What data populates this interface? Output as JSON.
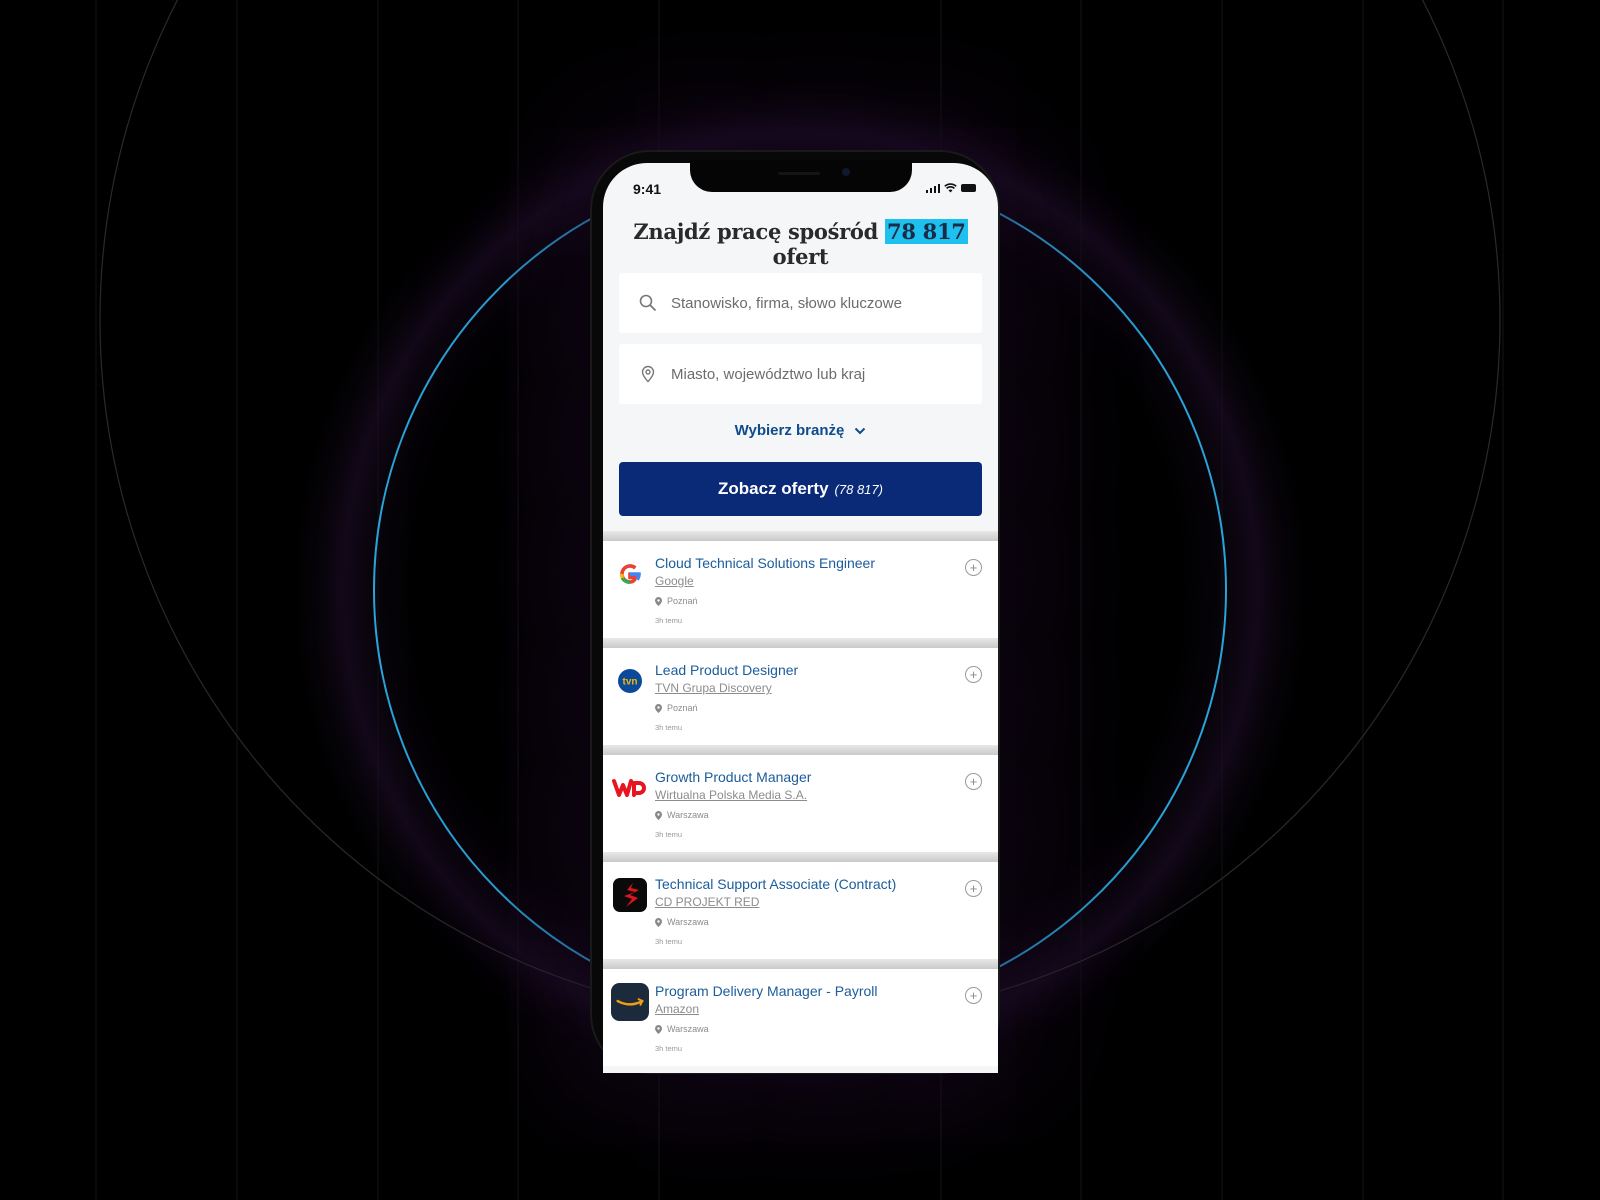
{
  "status_bar": {
    "time": "9:41"
  },
  "headline": {
    "prefix": "Znajdź pracę spośród ",
    "count": "78 817",
    "suffix": " ofert"
  },
  "search": {
    "keyword_placeholder": "Stanowisko, firma, słowo kluczowe",
    "keyword_value": "",
    "location_placeholder": "Miasto, województwo lub kraj",
    "location_value": ""
  },
  "industry_select": {
    "label": "Wybierz branżę",
    "icon": "chevron-down-icon"
  },
  "cta": {
    "label": "Zobacz oferty",
    "count": "(78 817)"
  },
  "jobs": [
    {
      "title": "Cloud Technical Solutions Engineer",
      "company": "Google",
      "location": "Poznań",
      "age": "3h temu",
      "logo": "google-logo"
    },
    {
      "title": "Lead Product Designer",
      "company": "TVN Grupa Discovery",
      "location": "Poznań",
      "age": "3h temu",
      "logo": "tvn-logo"
    },
    {
      "title": "Growth Product Manager",
      "company": "Wirtualna Polska Media S.A.",
      "location": "Warszawa",
      "age": "3h temu",
      "logo": "wp-logo"
    },
    {
      "title": "Technical Support Associate (Contract)",
      "company": "CD PROJEKT RED",
      "location": "Warszawa",
      "age": "3h temu",
      "logo": "cdprojekt-logo"
    },
    {
      "title": "Program Delivery Manager - Payroll",
      "company": "Amazon",
      "location": "Warszawa",
      "age": "3h temu",
      "logo": "amazon-logo"
    }
  ],
  "colors": {
    "accent_blue": "#0a2a78",
    "highlight": "#1ec0f0",
    "link_blue": "#1b5c9a",
    "ring": "#29a3d8"
  }
}
